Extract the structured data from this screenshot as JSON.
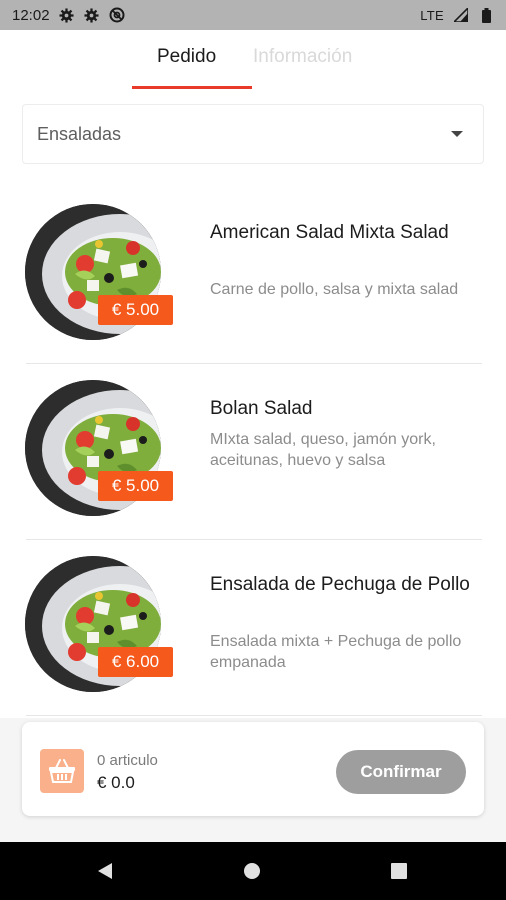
{
  "status_bar": {
    "time": "12:02",
    "network": "LTE",
    "icons": [
      "gear-icon",
      "gear-icon",
      "no-disturb-icon",
      "signal-icon",
      "battery-icon"
    ]
  },
  "tabs": [
    {
      "label": "Pedido",
      "active": true
    },
    {
      "label": "Información",
      "active": false
    }
  ],
  "category": {
    "selected": "Ensaladas"
  },
  "items": [
    {
      "title": "American Salad Mixta Salad",
      "description": "Carne de pollo, salsa y mixta salad",
      "price": "€ 5.00"
    },
    {
      "title": "Bolan Salad",
      "description": "MIxta salad, queso, jamón york, aceitunas, huevo y salsa",
      "price": "€ 5.00"
    },
    {
      "title": "Ensalada de Pechuga de Pollo",
      "description": "Ensalada mixta + Pechuga de pollo empanada",
      "price": "€ 6.00"
    }
  ],
  "cart": {
    "count_label": "0 articulo",
    "total": "€ 0.0",
    "confirm_label": "Confirmar"
  },
  "colors": {
    "accent": "#e8392b",
    "price_badge": "#f55a1c",
    "basket_bg": "#f9b08b",
    "confirm_bg": "#9e9e9e"
  }
}
